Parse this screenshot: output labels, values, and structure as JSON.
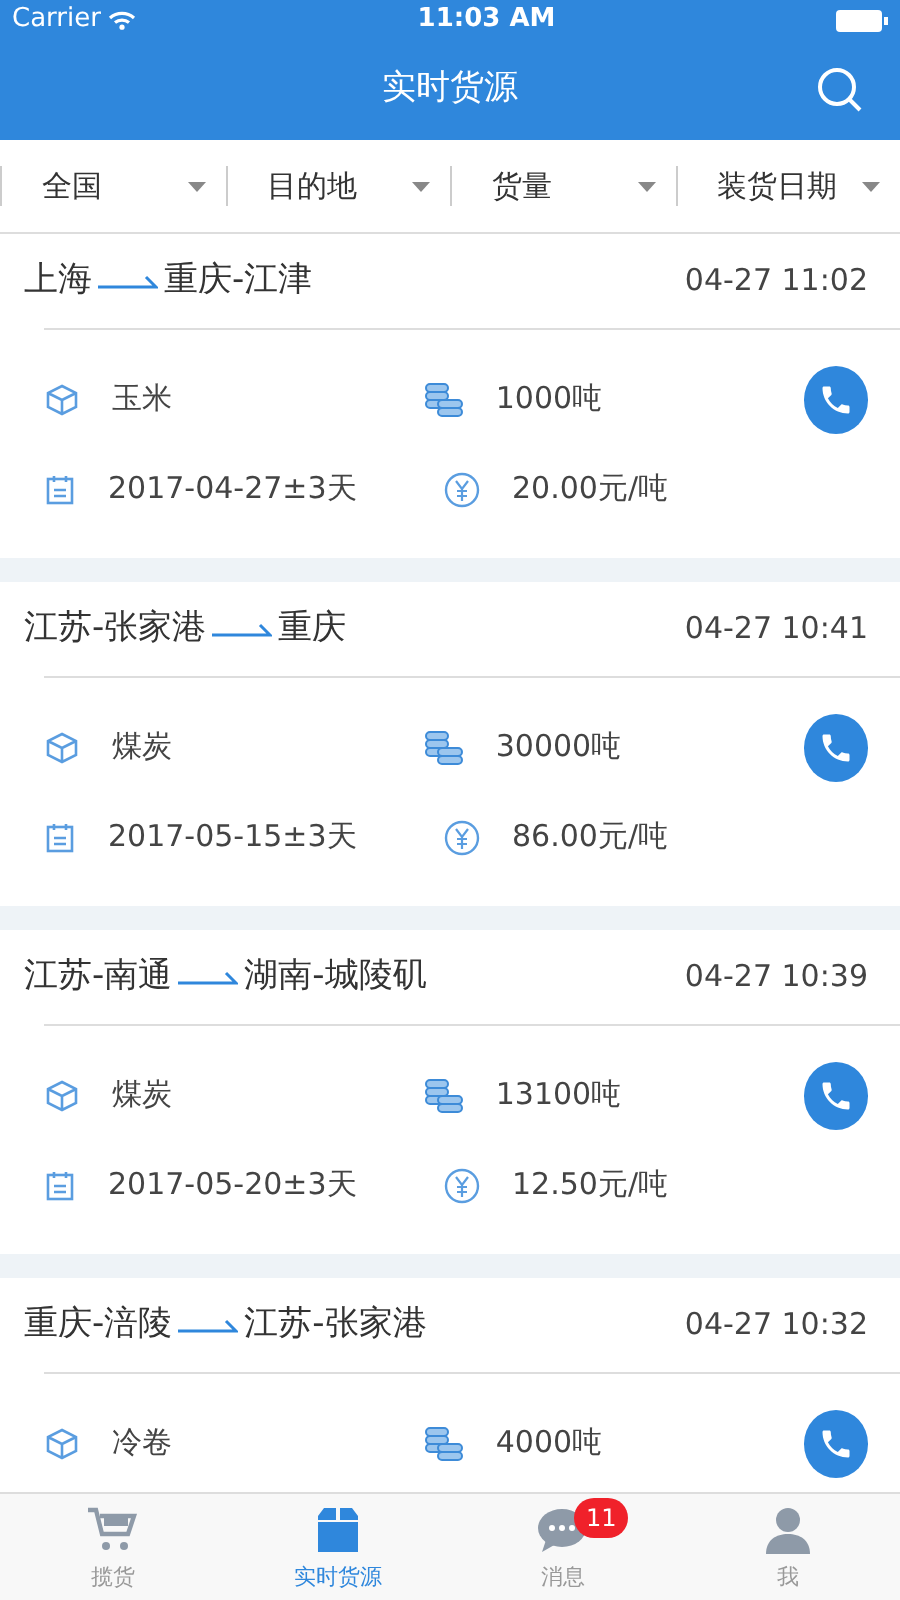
{
  "status_bar": {
    "carrier": "Carrier",
    "time": "11:03 AM"
  },
  "nav": {
    "title": "实时货源"
  },
  "filters": [
    {
      "label": "全国"
    },
    {
      "label": "目的地"
    },
    {
      "label": "货量"
    },
    {
      "label": "装货日期"
    }
  ],
  "listings": [
    {
      "origin": "上海",
      "destination": "重庆-江津",
      "time": "04-27 11:02",
      "goods": "玉米",
      "weight": "1000吨",
      "date": "2017-04-27±3天",
      "price": "20.00元/吨"
    },
    {
      "origin": "江苏-张家港",
      "destination": "重庆",
      "time": "04-27 10:41",
      "goods": "煤炭",
      "weight": "30000吨",
      "date": "2017-05-15±3天",
      "price": "86.00元/吨"
    },
    {
      "origin": "江苏-南通",
      "destination": "湖南-城陵矶",
      "time": "04-27 10:39",
      "goods": "煤炭",
      "weight": "13100吨",
      "date": "2017-05-20±3天",
      "price": "12.50元/吨"
    },
    {
      "origin": "重庆-涪陵",
      "destination": "江苏-张家港",
      "time": "04-27 10:32",
      "goods": "冷卷",
      "weight": "4000吨"
    }
  ],
  "tab_bar": [
    {
      "label": "揽货",
      "selected": false
    },
    {
      "label": "实时货源",
      "selected": true
    },
    {
      "label": "消息",
      "selected": false,
      "badge": "11"
    },
    {
      "label": "我",
      "selected": false
    }
  ]
}
